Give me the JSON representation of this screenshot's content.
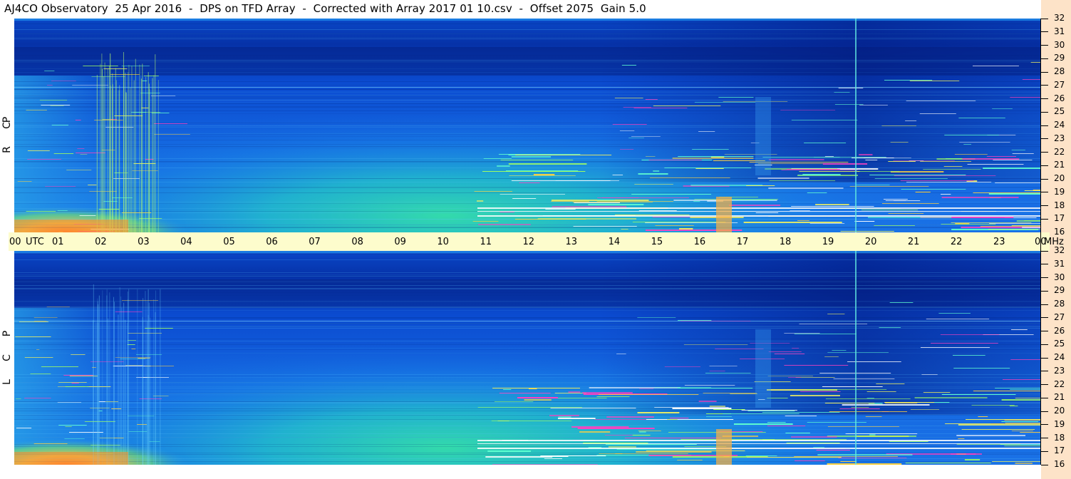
{
  "title": "AJ4CO Observatory  25 Apr 2016  -  DPS on TFD Array  -  Corrected with Array 2017 01 10.csv  -  Offset 2075  Gain 5.0",
  "panels": [
    {
      "id": "rcp",
      "letters": [
        "R",
        "C",
        "P"
      ]
    },
    {
      "id": "lcp",
      "letters": [
        "L",
        "C",
        "P"
      ]
    }
  ],
  "time_axis": {
    "labels": [
      "00",
      "UTC",
      "01",
      "02",
      "03",
      "04",
      "05",
      "06",
      "07",
      "08",
      "09",
      "10",
      "11",
      "12",
      "13",
      "14",
      "15",
      "16",
      "17",
      "18",
      "19",
      "20",
      "21",
      "22",
      "23",
      "00",
      "MHz"
    ]
  },
  "colors": {
    "time_axis_bg": "#fdfccc",
    "freq_axis_bg": "#fde3c8"
  },
  "chart_data": [
    {
      "type": "heatmap",
      "title": "AJ4CO Observatory  25 Apr 2016  -  DPS on TFD Array  -  Corrected with Array 2017 01 10.csv  -  Offset 2075  Gain 5.0",
      "ylabel": "R C P",
      "x_unit": "UTC",
      "y_unit": "MHz",
      "xlim": [
        0,
        24
      ],
      "ylim": [
        16,
        32
      ],
      "x_ticks": [
        "00",
        "01",
        "02",
        "03",
        "04",
        "05",
        "06",
        "07",
        "08",
        "09",
        "10",
        "11",
        "12",
        "13",
        "14",
        "15",
        "16",
        "17",
        "18",
        "19",
        "20",
        "21",
        "22",
        "23",
        "00"
      ],
      "y_ticks": [
        16,
        17,
        18,
        19,
        20,
        21,
        22,
        23,
        24,
        25,
        26,
        27,
        28,
        29,
        30,
        31,
        32
      ]
    },
    {
      "type": "heatmap",
      "ylabel": "L C P",
      "x_unit": "UTC",
      "y_unit": "MHz",
      "xlim": [
        0,
        24
      ],
      "ylim": [
        16,
        32
      ],
      "x_ticks": [
        "00",
        "01",
        "02",
        "03",
        "04",
        "05",
        "06",
        "07",
        "08",
        "09",
        "10",
        "11",
        "12",
        "13",
        "14",
        "15",
        "16",
        "17",
        "18",
        "19",
        "20",
        "21",
        "22",
        "23",
        "00"
      ],
      "y_ticks": [
        16,
        17,
        18,
        19,
        20,
        21,
        22,
        23,
        24,
        25,
        26,
        27,
        28,
        29,
        30,
        31,
        32
      ]
    }
  ]
}
